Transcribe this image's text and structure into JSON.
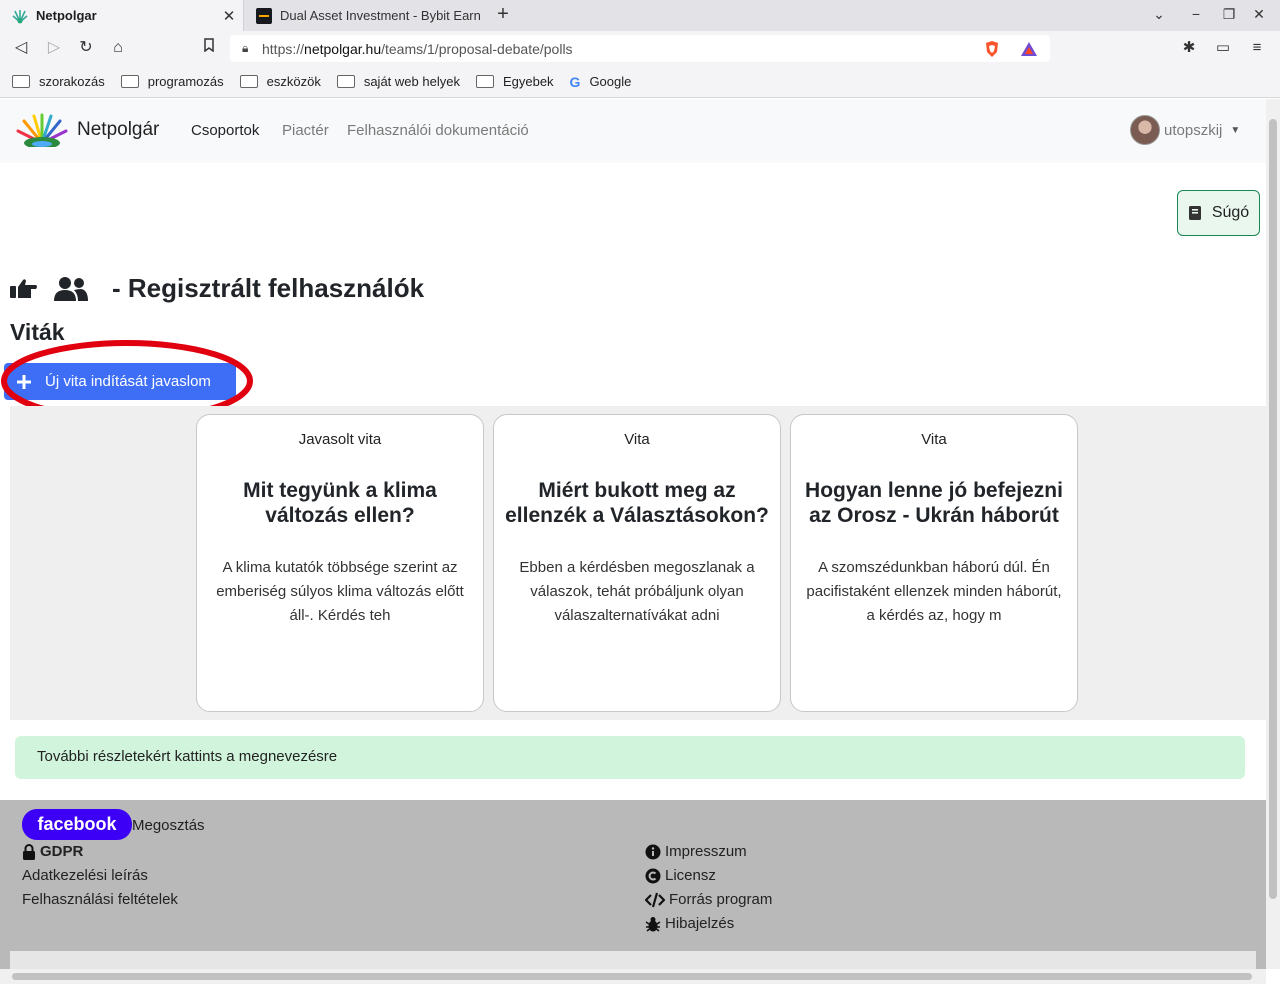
{
  "browser": {
    "tabs": [
      {
        "title": "Netpolgar",
        "active": true
      },
      {
        "title": "Dual Asset Investment - Bybit Earn",
        "active": false
      }
    ],
    "url_prefix": "https://",
    "url_host": "netpolgar.hu",
    "url_path": "/teams/1/proposal-debate/polls",
    "bookmarks": [
      "szorakozás",
      "programozás",
      "eszközök",
      "saját web helyek",
      "Egyebek",
      "Google"
    ]
  },
  "site": {
    "brand": "Netpolgár",
    "nav": [
      "Csoportok",
      "Piactér",
      "Felhasználói dokumentáció"
    ],
    "username": "utopszkij"
  },
  "help_button": "Súgó",
  "page_heading": "- Regisztrált felhasználók",
  "section_title": "Viták",
  "new_debate_button": "Új vita indítását javaslom",
  "cards": [
    {
      "kind": "Javasolt vita",
      "title": "Mit tegyünk a klima változás ellen?",
      "desc": "A klima kutatók többsége szerint az emberiség súlyos klima változás előtt áll-. Kérdés teh"
    },
    {
      "kind": "Vita",
      "title": "Miért bukott meg az ellenzék a Választásokon?",
      "desc": "Ebben a kérdésben megoszlanak a válaszok, tehát próbáljunk olyan válaszalternatívákat adni"
    },
    {
      "kind": "Vita",
      "title": "Hogyan lenne jó befejezni az Orosz - Ukrán háborút",
      "desc": "A szomszédunkban háború dúl. Én pacifistaként ellenzek minden háborút, a kérdés az, hogy m"
    }
  ],
  "info_text": "További részletekért kattints a megnevezésre",
  "footer": {
    "facebook": "facebook",
    "share": "Megosztás",
    "gdpr": "GDPR",
    "privacy": "Adatkezelési leírás",
    "terms": "Felhasználási feltételek",
    "impressum": "Impresszum",
    "license": "Licensz",
    "source": "Forrás program",
    "bugreport": "Hibajelzés"
  },
  "colors": {
    "primary_button": "#3d6ef5",
    "facebook_button": "#3b00f5",
    "info_bg": "#d1f5dc",
    "highlight_ring": "#e0000f"
  }
}
